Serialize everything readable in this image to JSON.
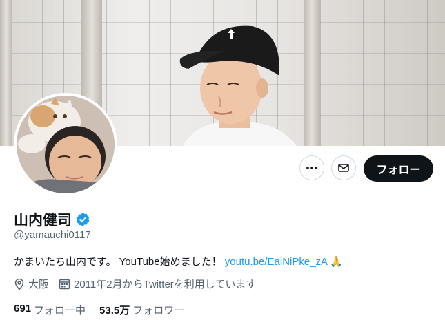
{
  "profile": {
    "name": "山内健司",
    "handle": "@yamauchi0117",
    "bio_text": "かまいたち山内です。 YouTube始めました！",
    "bio_link": "youtu.be/EaiNiPke_zA",
    "bio_emoji": "🙏",
    "location": "大阪",
    "joined": "2011年2月からTwitterを利用しています",
    "following_count": "691",
    "following_label": "フォロー中",
    "followers_count": "53.5万",
    "followers_label": "フォロワー"
  },
  "actions": {
    "follow_label": "フォロー"
  },
  "icons": [
    "more-icon",
    "message-icon",
    "verified-badge-icon",
    "location-icon",
    "calendar-icon"
  ],
  "colors": {
    "link": "#1d9bf0",
    "verified": "#1d9bf0",
    "follow_button_bg": "#0f1419",
    "secondary_text": "#536471"
  }
}
